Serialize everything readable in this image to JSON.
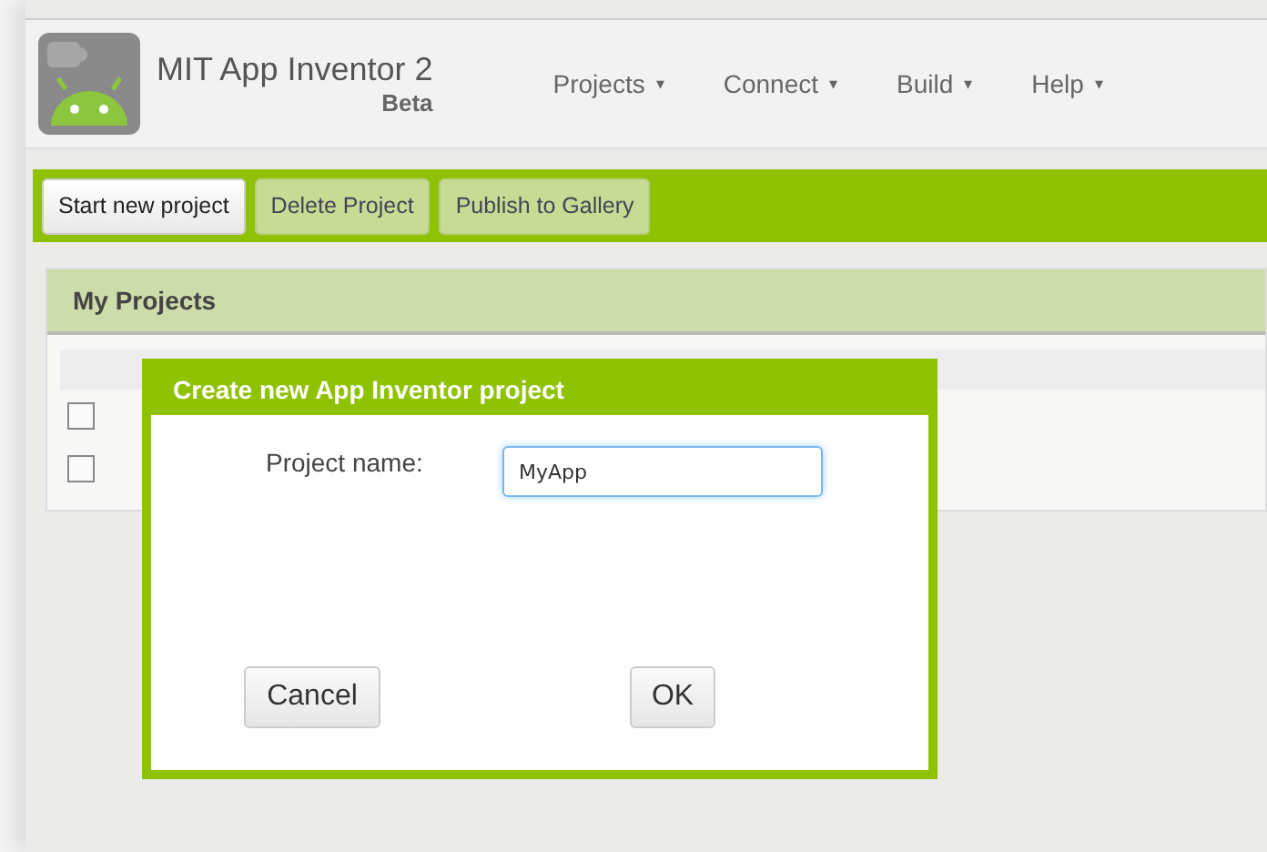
{
  "header": {
    "title": "MIT App Inventor 2",
    "subtitle": "Beta",
    "menus": [
      {
        "label": "Projects",
        "caret": "▾"
      },
      {
        "label": "Connect",
        "caret": "▾"
      },
      {
        "label": "Build",
        "caret": "▾"
      },
      {
        "label": "Help",
        "caret": "▾"
      }
    ]
  },
  "toolbar": {
    "buttons": [
      {
        "label": "Start new project",
        "selected": true
      },
      {
        "label": "Delete Project",
        "selected": false
      },
      {
        "label": "Publish to Gallery",
        "selected": false
      }
    ]
  },
  "projects_panel": {
    "title": "My Projects",
    "rows": [
      {
        "checked": false
      },
      {
        "checked": false
      }
    ]
  },
  "dialog": {
    "title": "Create new App Inventor project",
    "field_label": "Project name:",
    "field_value": "MyApp",
    "buttons": [
      "Cancel",
      "OK"
    ]
  }
}
